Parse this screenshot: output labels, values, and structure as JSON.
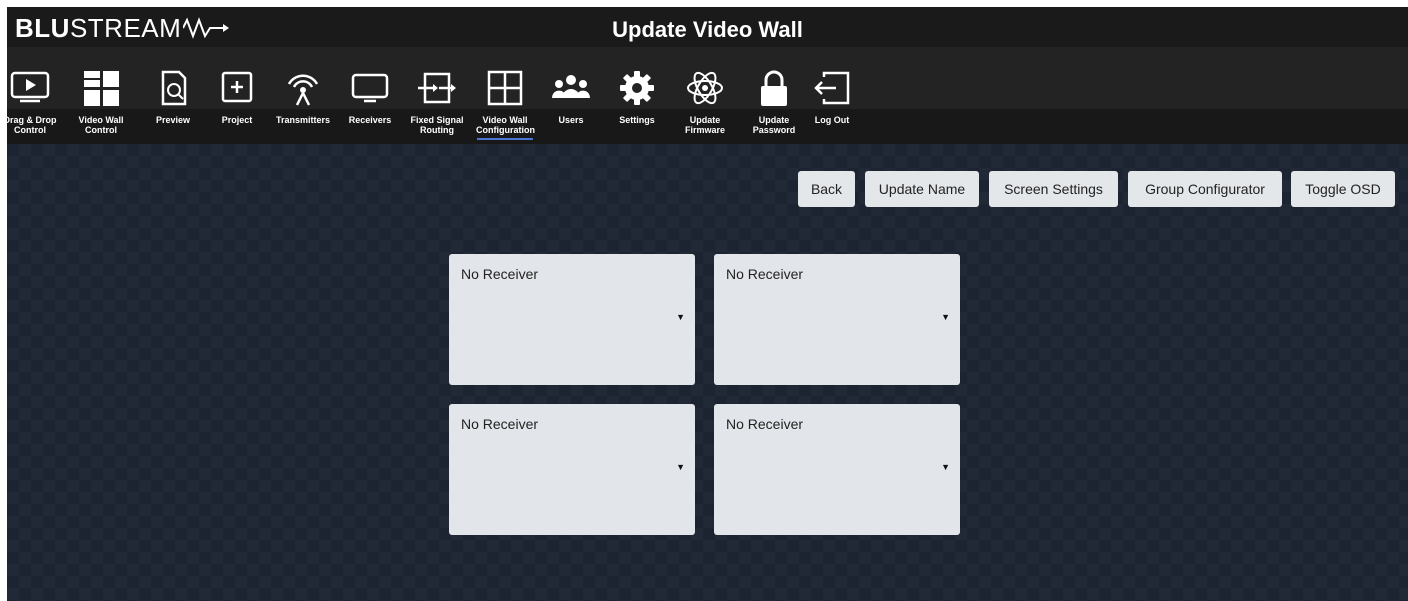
{
  "brand": {
    "logo_bold": "BLU",
    "logo_light": "STREAM"
  },
  "page_title": "Update Video Wall",
  "nav": {
    "items": [
      {
        "label": "Drag & Drop Control",
        "icon": "play-icon"
      },
      {
        "label": "Video Wall Control",
        "icon": "video-wall-icon"
      },
      {
        "label": "Preview",
        "icon": "preview-icon"
      },
      {
        "label": "Project",
        "icon": "project-icon"
      },
      {
        "label": "Transmitters",
        "icon": "transmitter-icon"
      },
      {
        "label": "Receivers",
        "icon": "receiver-icon"
      },
      {
        "label": "Fixed Signal Routing",
        "icon": "routing-icon"
      },
      {
        "label": "Video Wall Configuration",
        "icon": "grid-icon",
        "active": true
      },
      {
        "label": "Users",
        "icon": "users-icon"
      },
      {
        "label": "Settings",
        "icon": "gear-icon"
      },
      {
        "label": "Update Firmware",
        "icon": "atom-icon"
      },
      {
        "label": "Update Password",
        "icon": "lock-icon"
      },
      {
        "label": "Log Out",
        "icon": "logout-icon"
      }
    ]
  },
  "toolbar": {
    "back": "Back",
    "update_name": "Update Name",
    "screen_settings": "Screen Settings",
    "group_configurator": "Group Configurator",
    "toggle_osd": "Toggle OSD"
  },
  "wall": {
    "screens": [
      {
        "value": "No Receiver"
      },
      {
        "value": "No Receiver"
      },
      {
        "value": "No Receiver"
      },
      {
        "value": "No Receiver"
      }
    ]
  },
  "colors": {
    "accent": "#4a74d2",
    "background": "#1c2431",
    "panel": "#e2e5e9"
  }
}
